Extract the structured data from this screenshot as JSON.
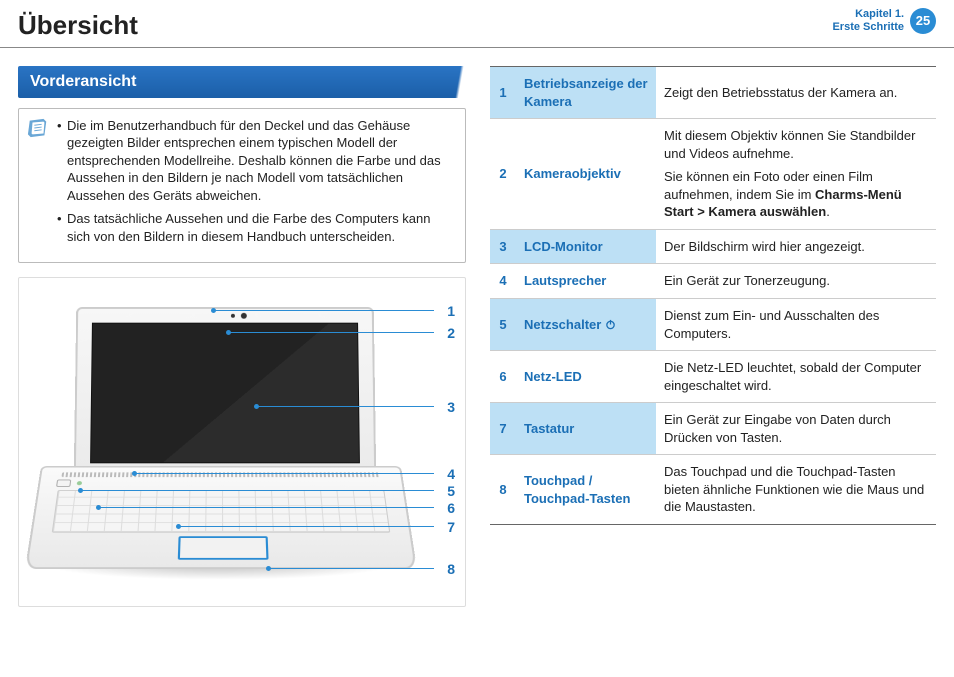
{
  "header": {
    "title": "Übersicht",
    "chapter_line1": "Kapitel 1.",
    "chapter_line2": "Erste Schritte",
    "page_number": "25"
  },
  "section": {
    "heading": "Vorderansicht"
  },
  "notes": {
    "item1": "Die im Benutzerhandbuch für den Deckel und das Gehäuse gezeigten Bilder entsprechen einem typischen Modell der entsprechenden Modellreihe. Deshalb können die Farbe und das Aussehen in den Bildern je nach Modell vom tatsächlichen Aussehen des Geräts abweichen.",
    "item2": "Das tatsächliche Aussehen und die Farbe des Computers kann sich von den Bildern in diesem Handbuch unterscheiden."
  },
  "callouts": {
    "n1": "1",
    "n2": "2",
    "n3": "3",
    "n4": "4",
    "n5": "5",
    "n6": "6",
    "n7": "7",
    "n8": "8"
  },
  "table": {
    "rows": [
      {
        "num": "1",
        "name": "Betriebsanzeige der Kamera",
        "desc": "Zeigt den Betriebsstatus der Kamera an.",
        "hl": true
      },
      {
        "num": "2",
        "name": "Kameraobjektiv",
        "desc_p1": "Mit diesem Objektiv können Sie Standbilder und Videos aufnehme.",
        "desc_p2_a": "Sie können ein Foto oder einen Film aufnehmen, indem Sie im ",
        "desc_p2_b": "Charms-Menü Start > Kamera auswählen",
        "desc_p2_c": "."
      },
      {
        "num": "3",
        "name": "LCD-Monitor",
        "desc": "Der Bildschirm wird hier angezeigt.",
        "hl": true
      },
      {
        "num": "4",
        "name": "Lautsprecher",
        "desc": "Ein Gerät zur Tonerzeugung."
      },
      {
        "num": "5",
        "name": "Netzschalter",
        "power_icon": true,
        "desc": "Dienst zum Ein- und Ausschalten des Computers.",
        "hl": true
      },
      {
        "num": "6",
        "name": "Netz-LED",
        "desc": "Die Netz-LED leuchtet, sobald der Computer eingeschaltet wird."
      },
      {
        "num": "7",
        "name": "Tastatur",
        "desc": "Ein Gerät zur Eingabe von Daten durch Drücken von Tasten.",
        "hl": true
      },
      {
        "num": "8",
        "name": "Touchpad / Touchpad-Tasten",
        "desc": "Das Touchpad und die Touchpad-Tasten bieten ähnliche Funktionen wie die Maus und die Maustasten."
      }
    ]
  }
}
